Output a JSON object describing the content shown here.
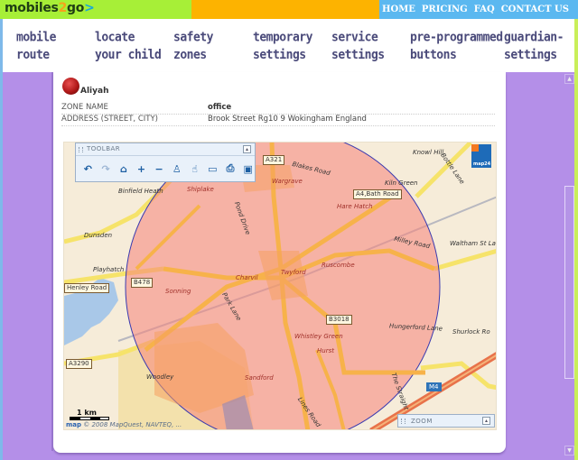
{
  "header": {
    "logo": {
      "part1": "mobiles",
      "part2": "2",
      "part3": "go",
      "chevron": ">"
    },
    "top_links": [
      "HOME",
      "PRICING",
      "FAQ",
      "CONTACT US"
    ],
    "colors": {
      "green": "#a7ef37",
      "orange": "#fdb300",
      "blue": "#5bb8f0",
      "page_bg": "#b48fe8"
    }
  },
  "nav": [
    {
      "line1": "mobile",
      "line2": "route"
    },
    {
      "line1": "locate",
      "line2": "your child"
    },
    {
      "line1": "safety",
      "line2": "zones"
    },
    {
      "line1": "temporary",
      "line2": "settings"
    },
    {
      "line1": "service",
      "line2": "settings"
    },
    {
      "line1": "pre-programmed",
      "line2": "buttons"
    },
    {
      "line1": "guardian-",
      "line2": "settings"
    }
  ],
  "person": {
    "name": "Aliyah",
    "icon": "red-ball-icon"
  },
  "zone": {
    "name_label": "ZONE NAME",
    "name_value": "office",
    "address_label": "ADDRESS (STREET, CITY)",
    "address_value": "Brook Street Rg10 9 Wokingham England"
  },
  "map": {
    "toolbar_title": "TOOLBAR",
    "collapse_glyph": "▴",
    "tools": [
      {
        "name": "back-icon",
        "glyph": "↶",
        "enabled": true
      },
      {
        "name": "forward-icon",
        "glyph": "↷",
        "enabled": false
      },
      {
        "name": "home-lock-icon",
        "glyph": "⌂",
        "enabled": true
      },
      {
        "name": "zoom-in-icon",
        "glyph": "+",
        "enabled": true
      },
      {
        "name": "zoom-out-icon",
        "glyph": "−",
        "enabled": true
      },
      {
        "name": "street-view-person-icon",
        "glyph": "♙",
        "enabled": true
      },
      {
        "name": "pan-hand-icon",
        "glyph": "☝",
        "enabled": true
      },
      {
        "name": "measure-icon",
        "glyph": "▭",
        "enabled": true
      },
      {
        "name": "print-icon",
        "glyph": "⎙",
        "enabled": true
      },
      {
        "name": "window-icon",
        "glyph": "▣",
        "enabled": true
      }
    ],
    "provider_logo_text": "map24",
    "zoom_widget_title": "ZOOM",
    "scale_label": "1 km",
    "copyright_brand": "map",
    "copyright_text": "© 2008 MapQuest, NAVTEQ, ...",
    "zone_circle_color": "#f5847a",
    "place_labels": [
      "Binfield Heath",
      "Shiplake",
      "Wargrave",
      "Blakes Road",
      "Kiln Green",
      "Knowl Hill",
      "Bottle Lane",
      "Hare Hatch",
      "Dunsden",
      "Playhatch",
      "Milley Road",
      "Waltham St Law",
      "Charvil",
      "Twyford",
      "Ruscombe",
      "Sonning",
      "Park Lane",
      "Hungerford Lane",
      "Shurlock Ro",
      "Whistley Green",
      "Hurst",
      "Woodley",
      "Sandford",
      "Lines Road",
      "The Straight",
      "Henley Road",
      "Pond Drive"
    ],
    "road_labels": [
      "A321",
      "A4,Bath Road",
      "B478",
      "B3018",
      "A3290"
    ],
    "motorway_label": "M4"
  },
  "scrollbar": {
    "up_glyph": "▲",
    "down_glyph": "▼"
  }
}
